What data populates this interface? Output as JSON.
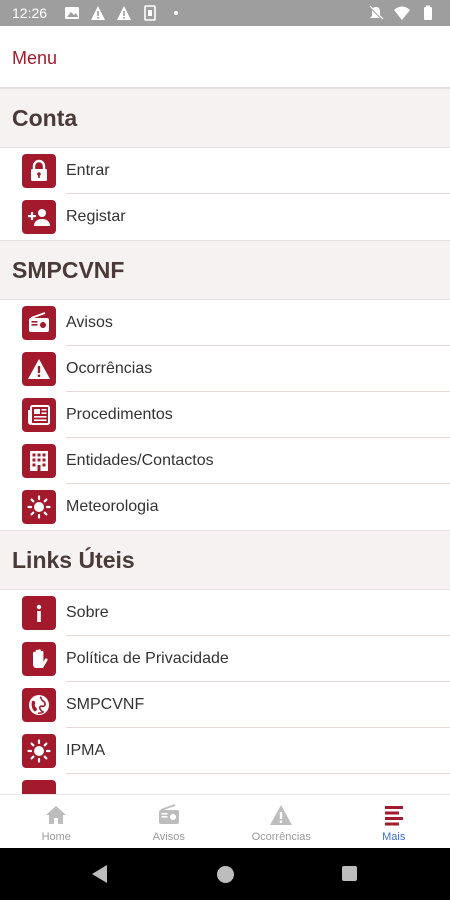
{
  "status_bar": {
    "time": "12:26",
    "left_icons": [
      "gallery-icon",
      "alert-icon",
      "alert-icon",
      "sim-icon",
      "dot-icon"
    ],
    "right_icons": [
      "mute-icon",
      "wifi-icon",
      "battery-icon"
    ]
  },
  "app_bar": {
    "title": "Menu"
  },
  "sections": [
    {
      "title": "Conta",
      "items": [
        {
          "label": "Entrar",
          "icon": "lock-icon"
        },
        {
          "label": "Registar",
          "icon": "add-user-icon"
        }
      ]
    },
    {
      "title": "SMPCVNF",
      "items": [
        {
          "label": "Avisos",
          "icon": "radio-icon"
        },
        {
          "label": "Ocorrências",
          "icon": "warning-icon"
        },
        {
          "label": "Procedimentos",
          "icon": "newspaper-icon"
        },
        {
          "label": "Entidades/Contactos",
          "icon": "building-icon"
        },
        {
          "label": "Meteorologia",
          "icon": "sun-icon"
        }
      ]
    },
    {
      "title": "Links Úteis",
      "items": [
        {
          "label": "Sobre",
          "icon": "info-icon"
        },
        {
          "label": "Política de Privacidade",
          "icon": "hand-icon"
        },
        {
          "label": "SMPCVNF",
          "icon": "globe-icon"
        },
        {
          "label": "IPMA",
          "icon": "sun-icon"
        }
      ]
    }
  ],
  "bottom_nav": {
    "items": [
      {
        "label": "Home",
        "icon": "home-icon",
        "active": false
      },
      {
        "label": "Avisos",
        "icon": "radio-icon",
        "active": false
      },
      {
        "label": "Ocorrências",
        "icon": "warning-icon",
        "active": false
      },
      {
        "label": "Mais",
        "icon": "menu-icon",
        "active": true
      }
    ]
  },
  "colors": {
    "accent": "#a31a2c",
    "active_nav": "#3a6fd8",
    "section_bg": "#f7f2f2"
  }
}
